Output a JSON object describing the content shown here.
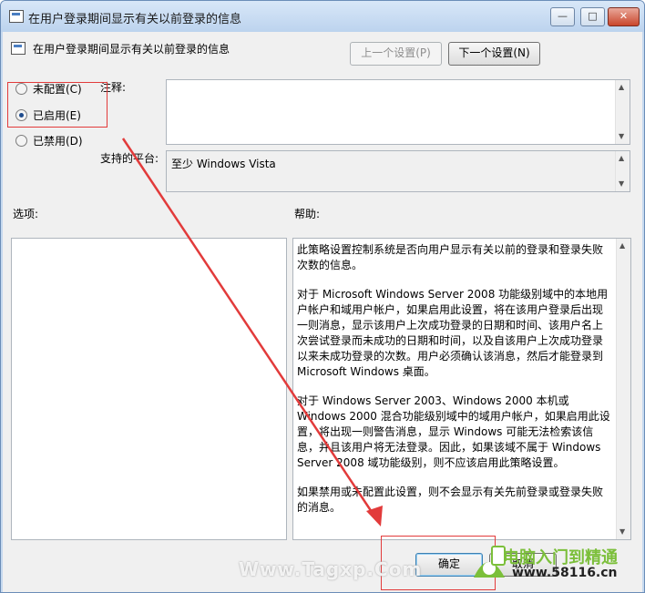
{
  "window": {
    "title": "在用户登录期间显示有关以前登录的信息",
    "controls": {
      "minimize": "—",
      "maximize": "□",
      "close": "✕"
    }
  },
  "header": {
    "title": "在用户登录期间显示有关以前登录的信息",
    "prev_button": "上一个设置(P)",
    "next_button": "下一个设置(N)"
  },
  "state": {
    "options": [
      {
        "label": "未配置(C)",
        "checked": false
      },
      {
        "label": "已启用(E)",
        "checked": true
      },
      {
        "label": "已禁用(D)",
        "checked": false
      }
    ]
  },
  "comment": {
    "label": "注释:",
    "value": ""
  },
  "platform": {
    "label": "支持的平台:",
    "value": "至少 Windows Vista"
  },
  "options_section": {
    "label": "选项:"
  },
  "help_section": {
    "label": "帮助:",
    "paragraphs": [
      "此策略设置控制系统是否向用户显示有关以前的登录和登录失败次数的信息。",
      "对于 Microsoft Windows Server 2008 功能级别域中的本地用户帐户和域用户帐户，如果启用此设置，将在该用户登录后出现一则消息，显示该用户上次成功登录的日期和时间、该用户名上次尝试登录而未成功的日期和时间，以及自该用户上次成功登录以来未成功登录的次数。用户必须确认该消息，然后才能登录到 Microsoft Windows 桌面。",
      "对于 Windows Server 2003、Windows 2000 本机或 Windows 2000 混合功能级别域中的域用户帐户，如果启用此设置，将出现一则警告消息，显示 Windows 可能无法检索该信息，并且该用户将无法登录。因此，如果该域不属于 Windows Server 2008 域功能级别，则不应该启用此策略设置。",
      "如果禁用或未配置此设置，则不会显示有关先前登录或登录失败的消息。"
    ]
  },
  "footer": {
    "ok_button": "确定",
    "cancel_button": "取消"
  },
  "watermarks": {
    "left": "Www.Tagxp.Com",
    "brand": "电脑入门到精通",
    "site": "www.58116.cn"
  },
  "colors": {
    "annotation": "#e23b3b",
    "brand_green": "#7bbf3a"
  }
}
